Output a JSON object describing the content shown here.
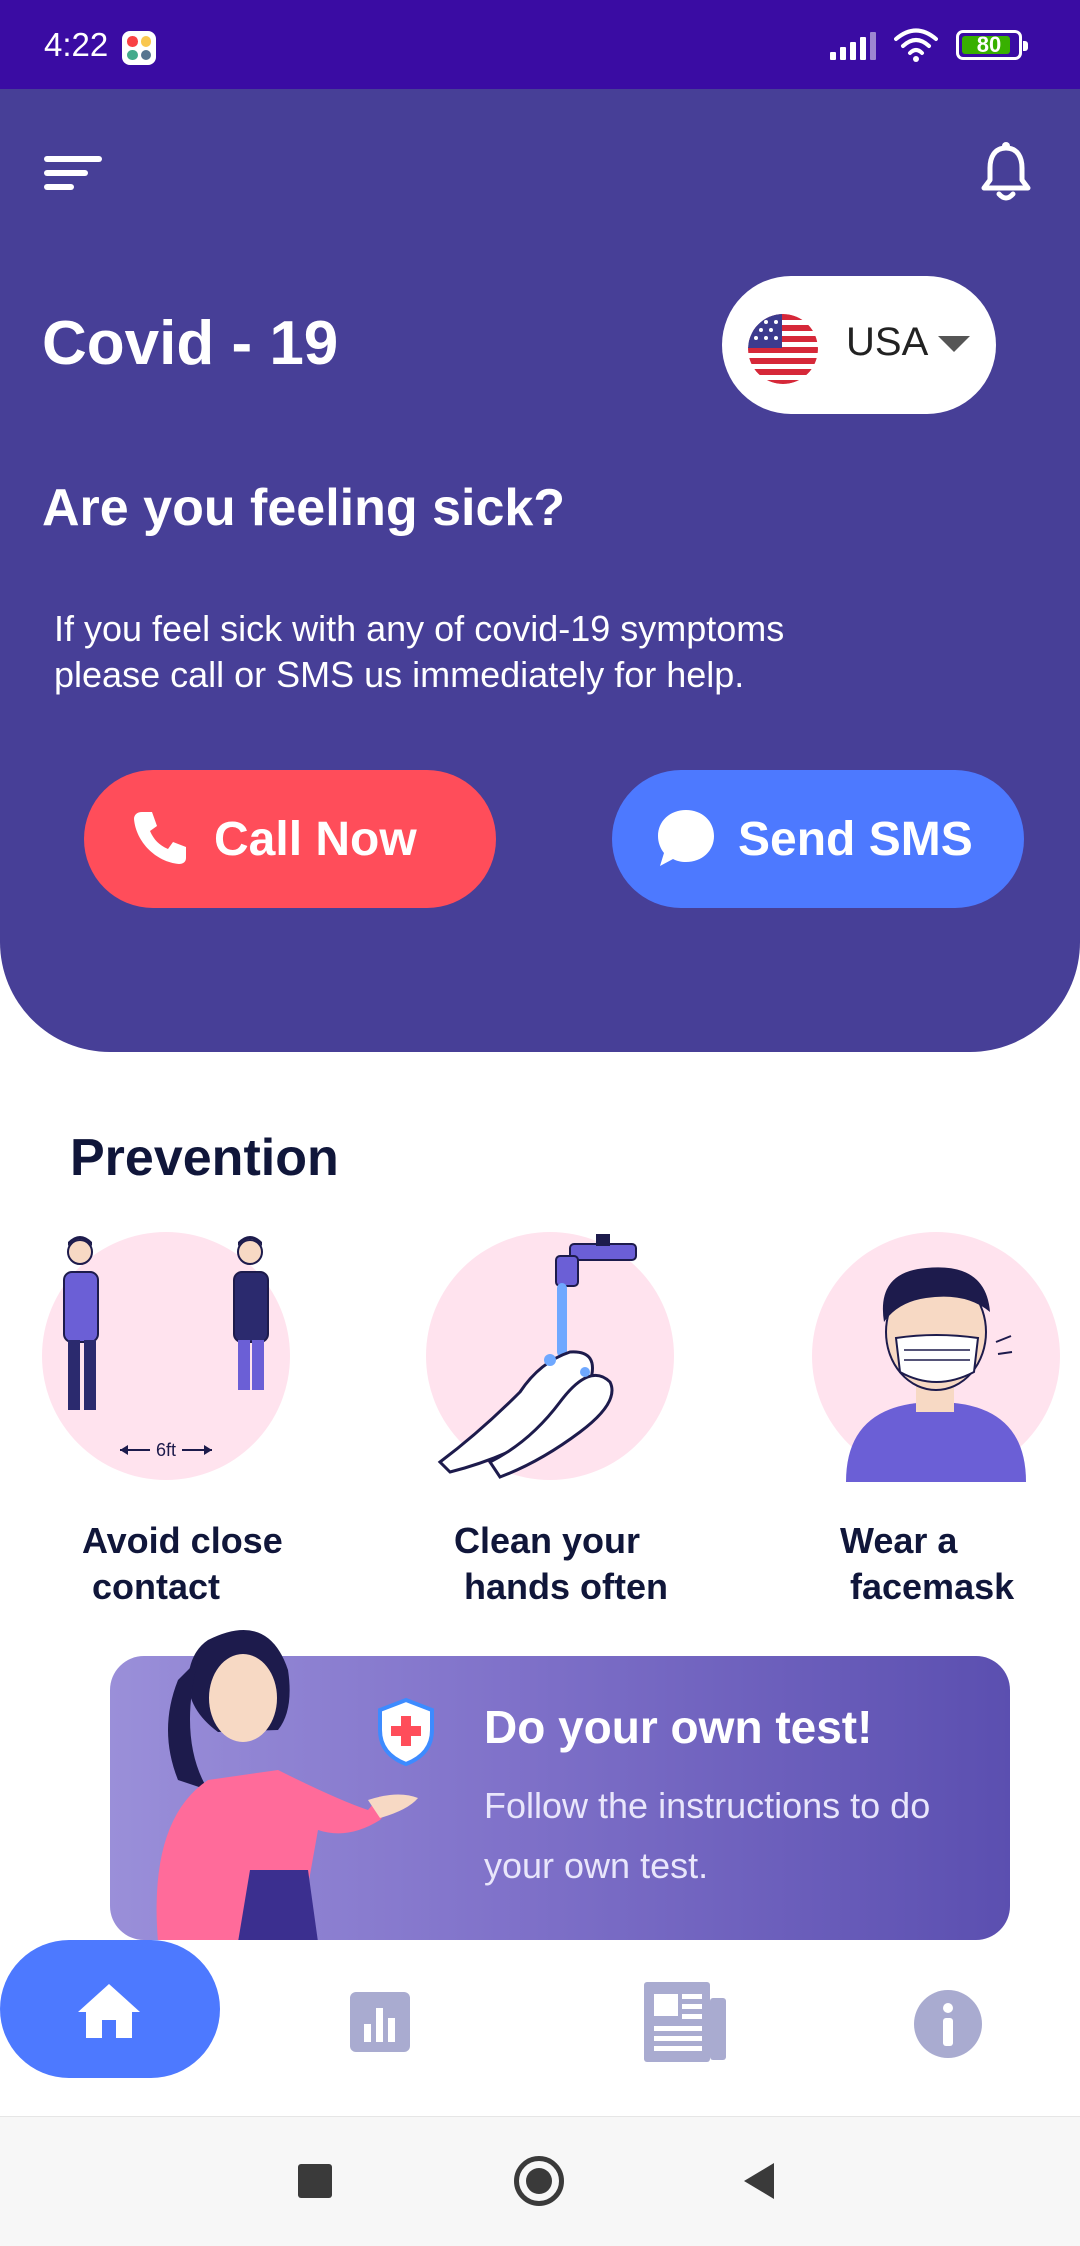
{
  "status_bar": {
    "time": "4:22",
    "battery": "80"
  },
  "header": {
    "title": "Covid - 19",
    "country": "USA",
    "question": "Are you feeling sick?",
    "message": "If you feel sick with any of covid-19 symptoms\n please call or SMS us immediately for help.",
    "call_label": "Call Now",
    "sms_label": "Send SMS"
  },
  "prevention": {
    "title": "Prevention",
    "items": [
      {
        "label": "Avoid close\n contact",
        "distance_label": "6ft"
      },
      {
        "label": "Clean your\n hands often"
      },
      {
        "label": "Wear a\n facemask"
      }
    ]
  },
  "test_banner": {
    "title": "Do your own test!",
    "subtitle": "Follow the instructions to do your own test."
  },
  "nav": {
    "items": [
      "home-icon",
      "stats-icon",
      "news-icon",
      "info-icon"
    ],
    "active": "home-icon"
  },
  "colors": {
    "header": "#473f97",
    "call": "#ff4d5a",
    "sms": "#4d79ff",
    "status_bar": "#3a0ca3"
  }
}
